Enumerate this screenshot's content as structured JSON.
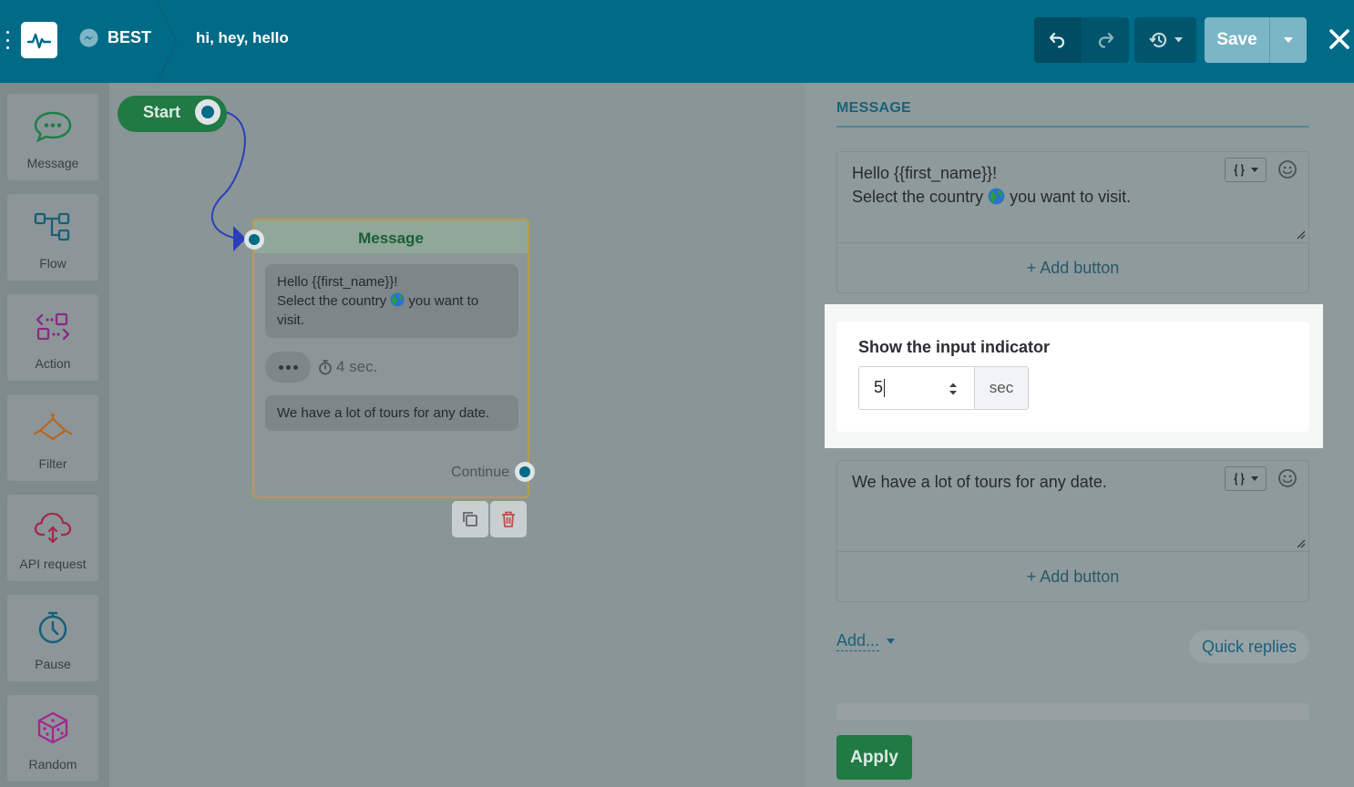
{
  "header": {
    "bot_name": "BEST",
    "flow_name": "hi, hey, hello",
    "save_label": "Save",
    "colors": {
      "bar": "#006b87",
      "save": "#7ab6c6"
    }
  },
  "sidebar": {
    "items": [
      {
        "label": "Message",
        "icon": "message-bubble-icon"
      },
      {
        "label": "Flow",
        "icon": "flow-icon"
      },
      {
        "label": "Action",
        "icon": "action-icon"
      },
      {
        "label": "Filter",
        "icon": "filter-icon"
      },
      {
        "label": "API request",
        "icon": "cloud-api-icon"
      },
      {
        "label": "Pause",
        "icon": "timer-icon"
      },
      {
        "label": "Random",
        "icon": "dice-icon"
      }
    ]
  },
  "canvas": {
    "start_label": "Start",
    "node": {
      "title": "Message",
      "message1": {
        "line1": "Hello  {{first_name}}!",
        "line2a": "Select the country",
        "line2b": "you want to visit."
      },
      "typing_time": "4 sec.",
      "message2": "We have a lot of tours for any date.",
      "continue_label": "Continue"
    }
  },
  "panel": {
    "title": "MESSAGE",
    "message1": {
      "line1": "Hello  {{first_name}}!",
      "line2a": "Select the country",
      "line2b": "you want to visit."
    },
    "add_button_label": "+ Add button",
    "indicator": {
      "title": "Show the input indicator",
      "value": "5",
      "unit": "sec"
    },
    "message2": "We have a lot of tours for any date.",
    "add_dropdown_label": "Add...",
    "quick_replies_label": "Quick replies",
    "apply_label": "Apply"
  }
}
